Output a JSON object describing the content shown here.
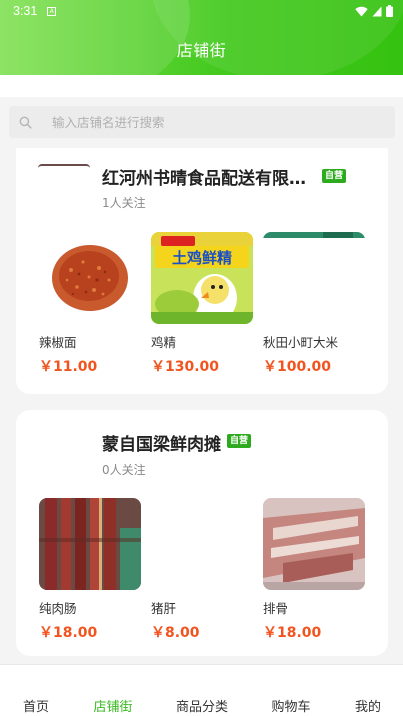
{
  "status_bar": {
    "time": "3:31",
    "notif_icon": "a-icon"
  },
  "header": {
    "title": "店铺街"
  },
  "search": {
    "placeholder": "输入店铺名进行搜索"
  },
  "shops": [
    {
      "name": "红河州书晴食品配送有限…",
      "badge": "自营",
      "followers": "1人关注",
      "products": [
        {
          "name": "辣椒面",
          "price": "￥11.00"
        },
        {
          "name": "鸡精",
          "price": "￥130.00",
          "package_text": "土鸡鲜精"
        },
        {
          "name": "秋田小町大米",
          "price": "￥100.00"
        }
      ]
    },
    {
      "name": "蒙自国梁鲜肉摊",
      "badge": "自营",
      "followers": "0人关注",
      "products": [
        {
          "name": "纯肉肠",
          "price": "￥18.00"
        },
        {
          "name": "猪肝",
          "price": "￥8.00"
        },
        {
          "name": "排骨",
          "price": "￥18.00"
        }
      ]
    }
  ],
  "nav": {
    "items": [
      "首页",
      "店铺街",
      "商品分类",
      "购物车",
      "我的"
    ],
    "active": "店铺街"
  },
  "colors": {
    "accent": "#39b91f",
    "price": "#f2541f",
    "badge": "#2daa1e"
  }
}
